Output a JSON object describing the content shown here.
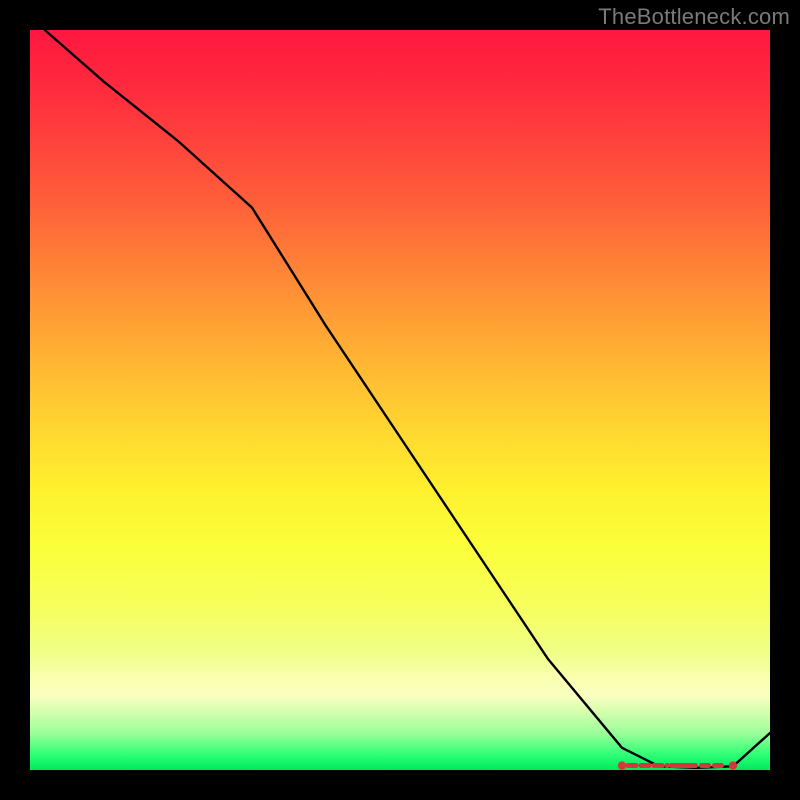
{
  "watermark": "TheBottleneck.com",
  "chart_data": {
    "type": "line",
    "title": "",
    "xlabel": "",
    "ylabel": "",
    "xlim": [
      0,
      100
    ],
    "ylim": [
      0,
      100
    ],
    "grid": false,
    "legend": false,
    "series": [
      {
        "name": "curve",
        "x": [
          2,
          10,
          20,
          30,
          40,
          50,
          60,
          70,
          80,
          85,
          90,
          95,
          100
        ],
        "y": [
          100,
          93,
          85,
          76,
          60,
          45,
          30,
          15,
          3,
          0.5,
          0.3,
          0.5,
          5
        ],
        "color": "#000000"
      }
    ],
    "marker_band": {
      "x_start": 80,
      "x_end": 95,
      "y": 0.6,
      "color": "#d13a3a"
    },
    "gradient_stops": [
      {
        "pos": 0,
        "color": "#ff173f"
      },
      {
        "pos": 50,
        "color": "#ffd730"
      },
      {
        "pos": 88,
        "color": "#f9ffc0"
      },
      {
        "pos": 100,
        "color": "#00e85e"
      }
    ]
  }
}
